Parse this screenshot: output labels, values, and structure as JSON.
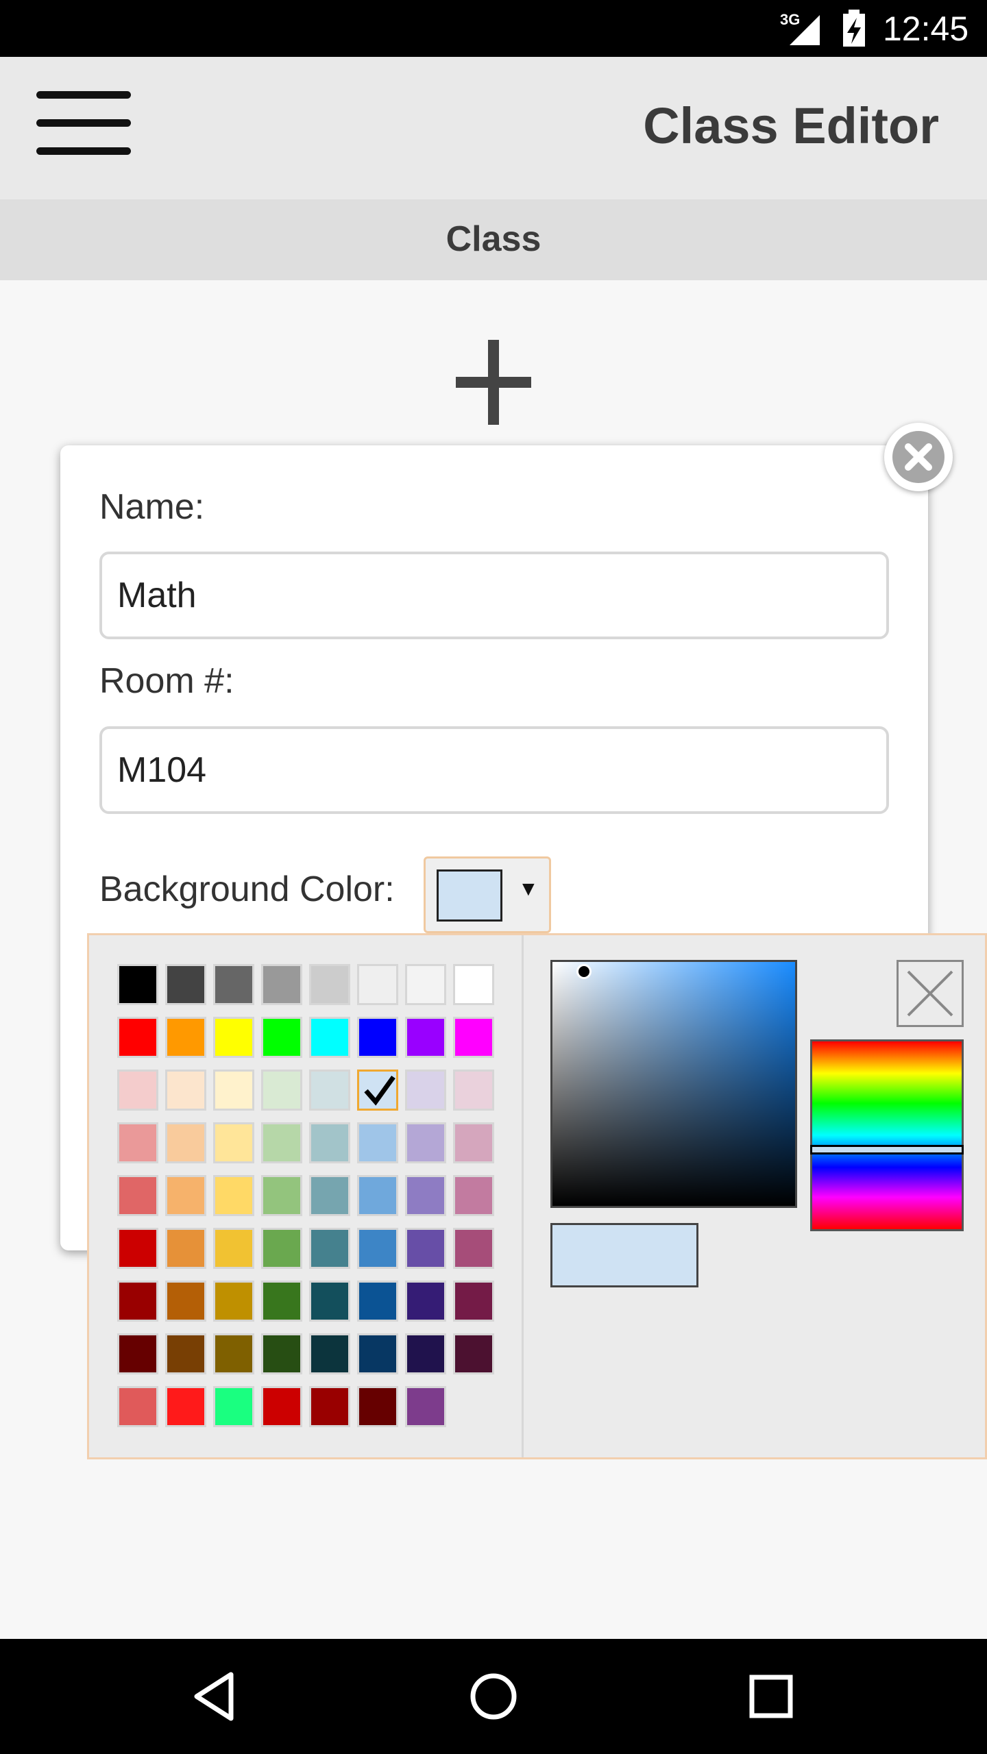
{
  "status_bar": {
    "network": "3G",
    "time": "12:45",
    "icons": [
      "signal-icon",
      "battery-charging-icon"
    ]
  },
  "app_bar": {
    "title": "Class Editor",
    "menu_icon": "hamburger-menu-icon"
  },
  "section": {
    "title": "Class",
    "add_icon": "plus-icon"
  },
  "dialog": {
    "name_label": "Name:",
    "name_value": "Math",
    "room_label": "Room #:",
    "room_value": "M104",
    "bg_color_label": "Background Color:",
    "selected_color": "#cfe2f3",
    "close_icon": "close-circle-icon"
  },
  "color_picker": {
    "selected_color": "#cfe2f3",
    "selected_index": 21,
    "palette": [
      "#000000",
      "#434343",
      "#666666",
      "#999999",
      "#cccccc",
      "#efefef",
      "#f3f3f3",
      "#ffffff",
      "#ff0000",
      "#ff9900",
      "#ffff00",
      "#00ff00",
      "#00ffff",
      "#0000ff",
      "#9900ff",
      "#ff00ff",
      "#f4cccc",
      "#fce5cd",
      "#fff2cc",
      "#d9ead3",
      "#d0e0e3",
      "#cfe2f3",
      "#d9d2e9",
      "#ead1dc",
      "#ea9999",
      "#f9cb9c",
      "#ffe599",
      "#b6d7a8",
      "#a2c4c9",
      "#9fc5e8",
      "#b4a7d6",
      "#d5a6bd",
      "#e06666",
      "#f6b26b",
      "#ffd966",
      "#93c47d",
      "#76a5af",
      "#6fa8dc",
      "#8e7cc3",
      "#c27ba0",
      "#cc0000",
      "#e69138",
      "#f1c232",
      "#6aa84f",
      "#45818e",
      "#3d85c6",
      "#674ea7",
      "#a64d79",
      "#990000",
      "#b45f06",
      "#bf9000",
      "#38761d",
      "#134f5c",
      "#0b5394",
      "#351c75",
      "#741b47",
      "#660000",
      "#783f04",
      "#7f6000",
      "#274e13",
      "#0c343d",
      "#073763",
      "#20124d",
      "#4c1130",
      "#e05a5a",
      "#ff1a1a",
      "#1aff80",
      "#cc0000",
      "#990000",
      "#660000",
      "#7d3c8c"
    ],
    "sv_hue_color": "#1a8cff",
    "hue_level": 0.58,
    "close_icon": "close-x-icon"
  },
  "nav_bar": {
    "icons": [
      "back-icon",
      "home-icon",
      "recents-icon"
    ]
  }
}
